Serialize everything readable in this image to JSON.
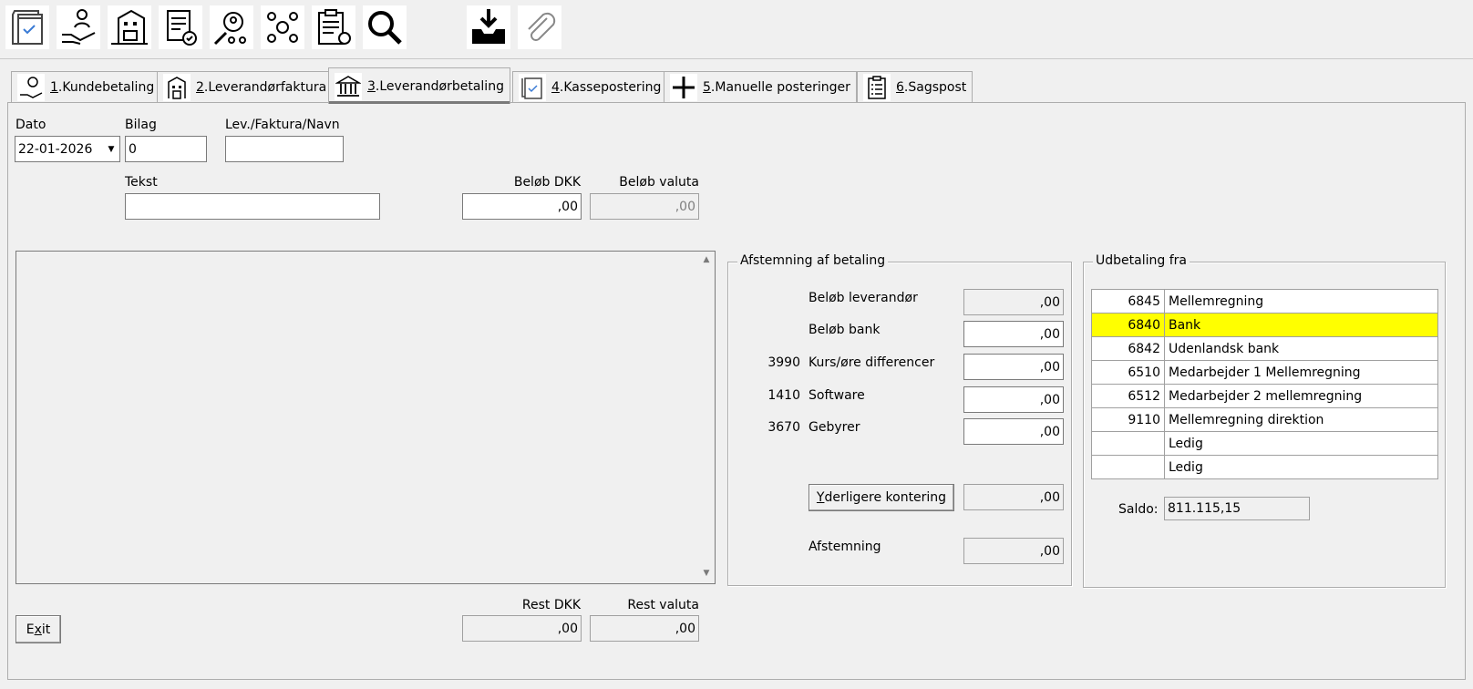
{
  "toolbar": {
    "icons": [
      "document-check-icon",
      "hand-person-icon",
      "building-truck-icon",
      "invoice-checklist-icon",
      "people-search-icon",
      "people-gear-icon",
      "clipboard-attach-icon",
      "search-icon",
      "inbox-download-icon",
      "paperclip-icon"
    ]
  },
  "tabs": [
    {
      "num": "1",
      "label": ".Kundebetaling",
      "icon": "money-hand-icon"
    },
    {
      "num": "2",
      "label": ".Leverandørfaktura",
      "icon": "building-icon"
    },
    {
      "num": "3",
      "label": ".Leverandørbetaling",
      "icon": "bank-icon"
    },
    {
      "num": "4",
      "label": ".Kassepostering",
      "icon": "document-check-icon"
    },
    {
      "num": "5",
      "label": ".Manuelle posteringer",
      "icon": "plus-icon"
    },
    {
      "num": "6",
      "label": ".Sagspost",
      "icon": "checklist-icon"
    }
  ],
  "form": {
    "dato_label": "Dato",
    "dato_value": "22-01-2026",
    "bilag_label": "Bilag",
    "bilag_value": "0",
    "lev_label": "Lev./Faktura/Navn",
    "lev_value": "",
    "tekst_label": "Tekst",
    "tekst_value": "",
    "belob_dkk_label": "Beløb DKK",
    "belob_dkk_value": ",00",
    "belob_valuta_label": "Beløb valuta",
    "belob_valuta_value": ",00",
    "rest_dkk_label": "Rest DKK",
    "rest_dkk_value": ",00",
    "rest_valuta_label": "Rest valuta",
    "rest_valuta_value": ",00",
    "exit_rest": "it",
    "exit_first": "E",
    "exit_u": "x"
  },
  "afstemning": {
    "title": "Afstemning af betaling",
    "rows": [
      {
        "acct": "",
        "label": "Beløb leverandør",
        "value": ",00"
      },
      {
        "acct": "",
        "label": "Beløb bank",
        "value": ",00"
      },
      {
        "acct": "3990",
        "label": "Kurs/øre differencer",
        "value": ",00"
      },
      {
        "acct": "1410",
        "label": "Software",
        "value": ",00"
      },
      {
        "acct": "3670",
        "label": "Gebyrer",
        "value": ",00"
      }
    ],
    "button_u": "Y",
    "button_rest": "derligere kontering",
    "yderligere_value": ",00",
    "afstemning_label": "Afstemning",
    "afstemning_value": ",00"
  },
  "udbetaling": {
    "title": "Udbetaling fra",
    "accounts": [
      {
        "no": "6845",
        "name": "Mellemregning"
      },
      {
        "no": "6840",
        "name": "Bank"
      },
      {
        "no": "6842",
        "name": "Udenlandsk bank"
      },
      {
        "no": "6510",
        "name": "Medarbejder 1 Mellemregning"
      },
      {
        "no": "6512",
        "name": "Medarbejder 2 mellemregning"
      },
      {
        "no": "9110",
        "name": "Mellemregning direktion"
      },
      {
        "no": "",
        "name": "Ledig"
      },
      {
        "no": "",
        "name": "Ledig"
      }
    ],
    "selected_color": "#ffff00",
    "saldo_label": "Saldo:",
    "saldo_value": "811.115,15"
  }
}
